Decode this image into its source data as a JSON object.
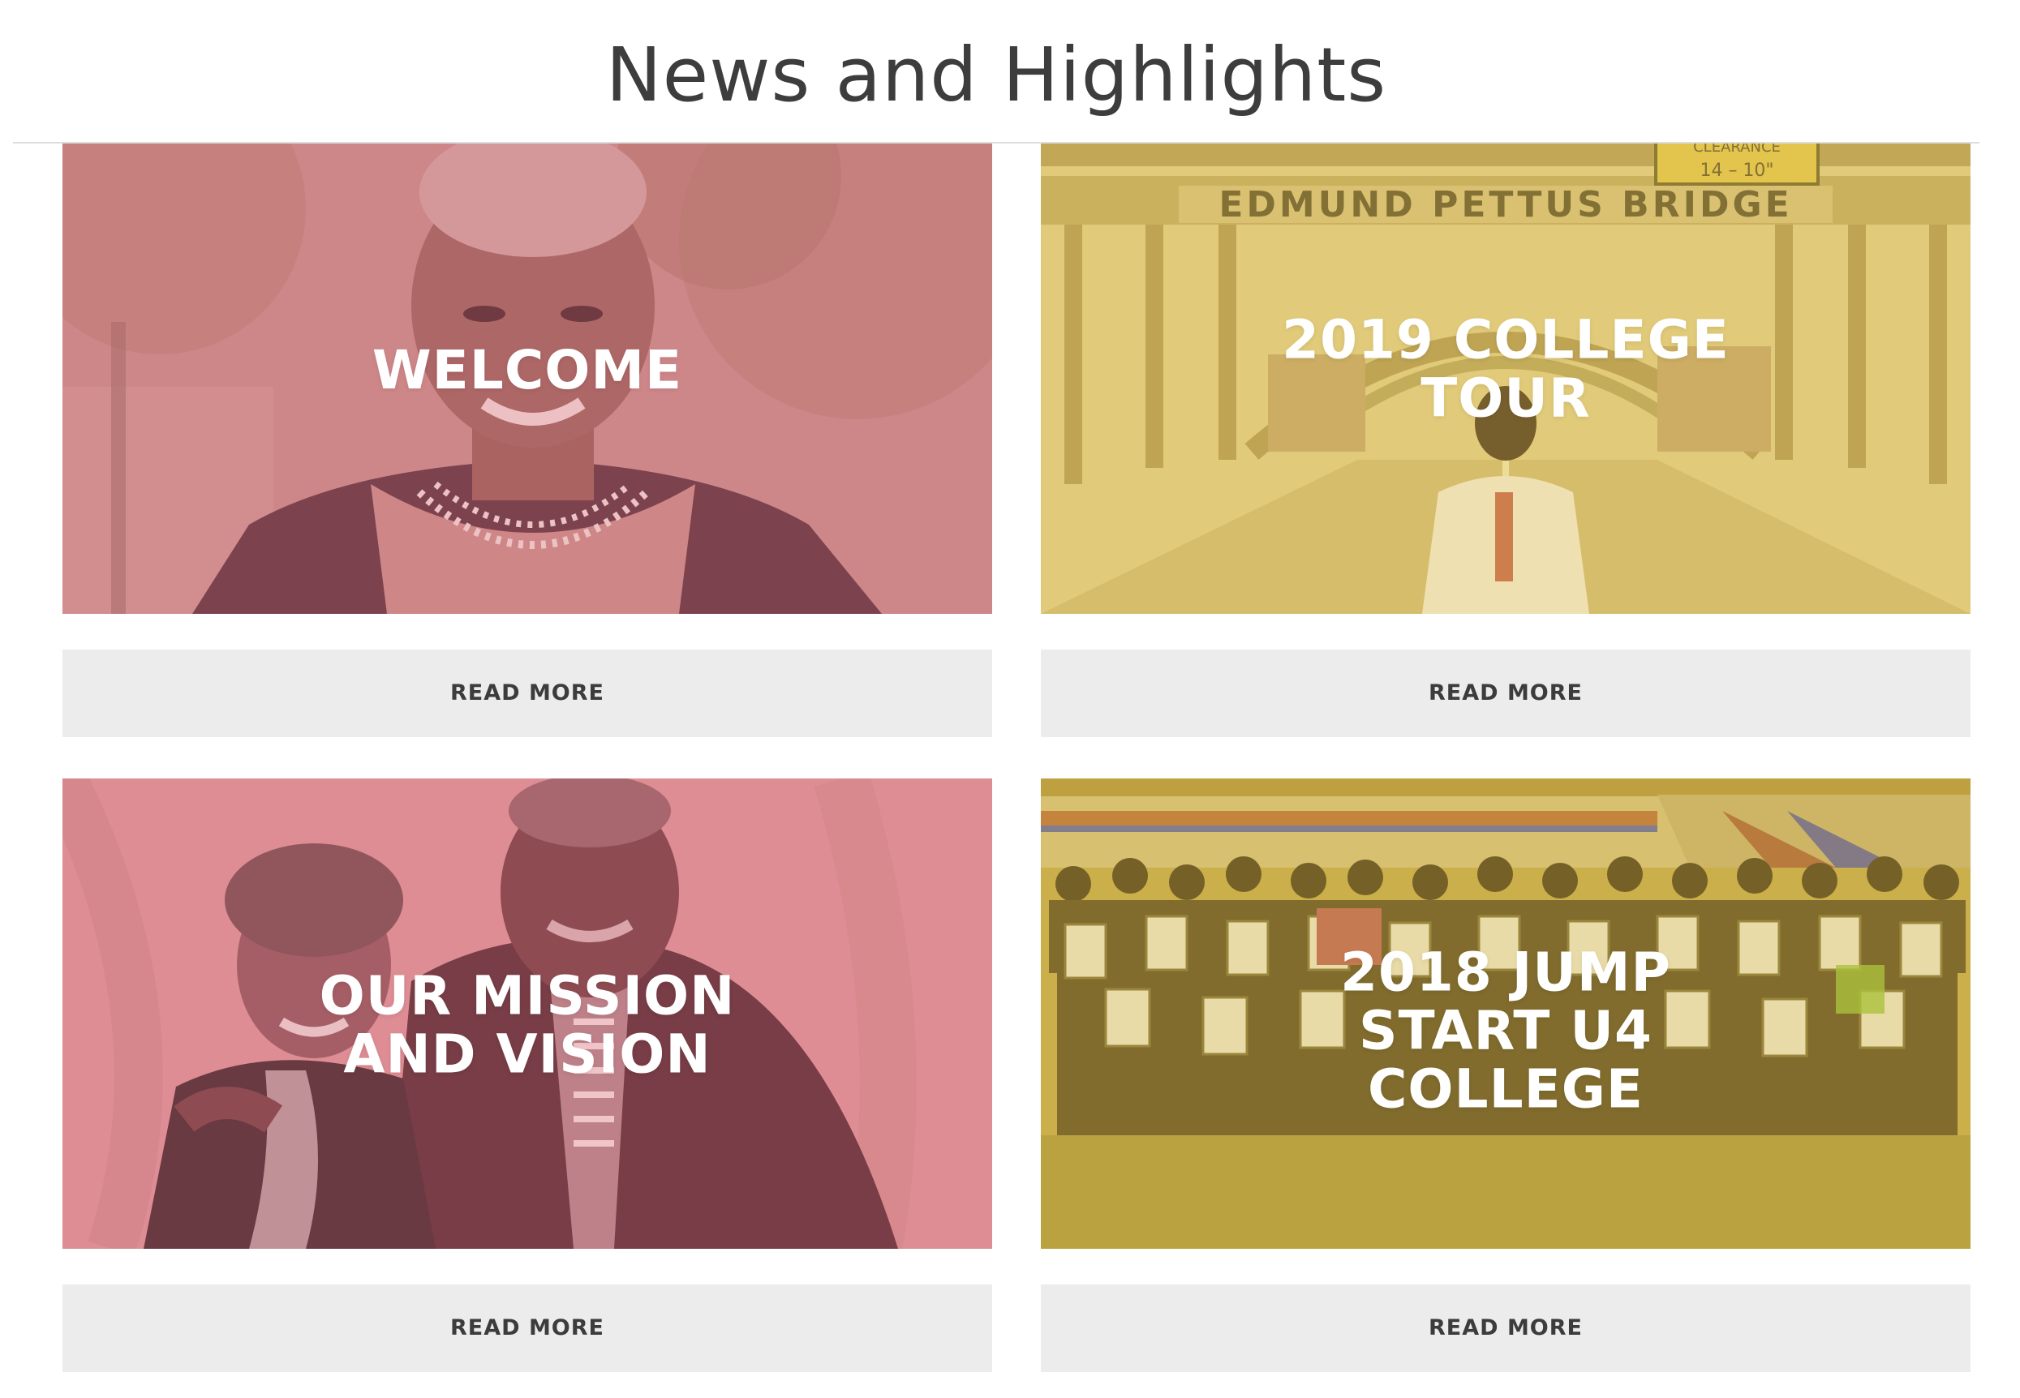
{
  "page": {
    "title": "News and Highlights"
  },
  "theme": {
    "pink_overlay": "#d9727d",
    "gold_overlay": "#d9b84a",
    "olive_overlay": "#c2a73e",
    "button_bg": "#ececec",
    "button_text": "#3c3c3c",
    "title_text": "#3d3d3d"
  },
  "cards": [
    {
      "title": "WELCOME",
      "button_label": "READ MORE",
      "image_desc_icon": "portrait-photo"
    },
    {
      "title": "2019 COLLEGE TOUR",
      "button_label": "READ MORE",
      "image_desc_icon": "bridge-photo",
      "sign_text": "EDMUND PETTUS BRIDGE",
      "clearance_text": "CLEARANCE",
      "clearance_value": "14 – 10\""
    },
    {
      "title": "OUR MISSION AND VISION",
      "button_label": "READ MORE",
      "image_desc_icon": "couple-photo"
    },
    {
      "title": "2018 JUMP START U4 COLLEGE",
      "button_label": "READ MORE",
      "image_desc_icon": "group-photo"
    }
  ]
}
